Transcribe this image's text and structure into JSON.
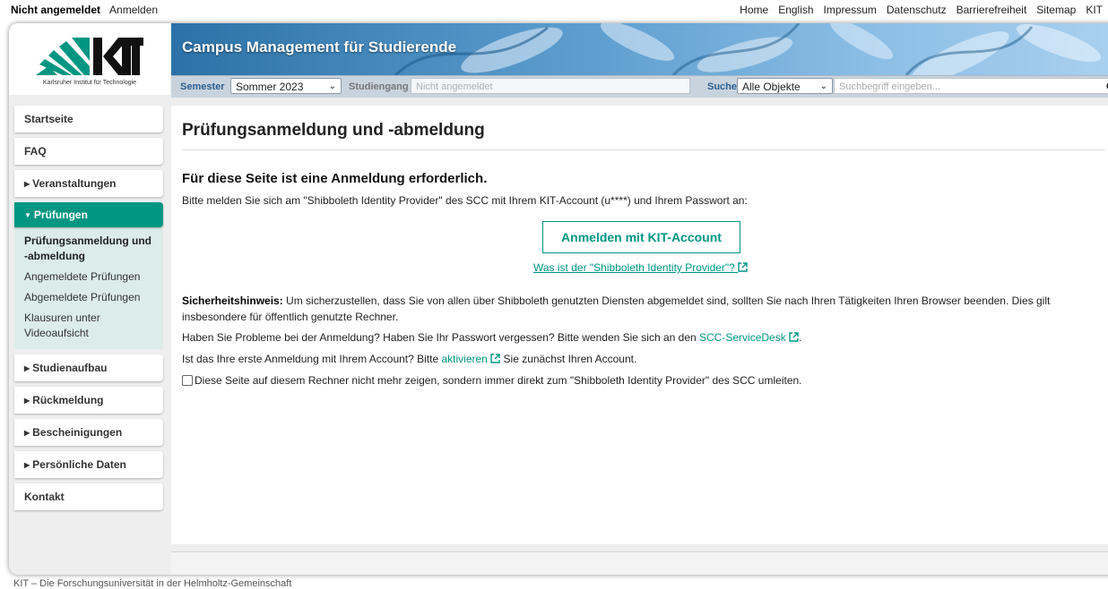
{
  "topbar": {
    "status": "Nicht angemeldet",
    "login_link": "Anmelden",
    "links": [
      "Home",
      "English",
      "Impressum",
      "Datenschutz",
      "Barrierefreiheit",
      "Sitemap",
      "KIT"
    ]
  },
  "header": {
    "logo_subtitle": "Karlsruher Institut für Technologie",
    "banner_title": "Campus Management für Studierende",
    "semester_label": "Semester",
    "semester_value": "Sommer 2023",
    "studiengang_label": "Studiengang",
    "studiengang_placeholder": "Nicht angemeldet",
    "search_label": "Suche",
    "search_scope": "Alle Objekte",
    "search_placeholder": "Suchbegriff eingeben..."
  },
  "sidebar": {
    "items_top": [
      {
        "label": "Startseite",
        "arrow": ""
      },
      {
        "label": "FAQ",
        "arrow": ""
      },
      {
        "label": "Veranstaltungen",
        "arrow": "▶"
      }
    ],
    "active": {
      "label": "Prüfungen",
      "arrow": "▼"
    },
    "sub_items": [
      "Prüfungsanmeldung und -abmeldung",
      "Angemeldete Prüfungen",
      "Abgemeldete Prüfungen",
      "Klausuren unter Videoaufsicht"
    ],
    "items_bottom": [
      {
        "label": "Studienaufbau",
        "arrow": "▶"
      },
      {
        "label": "Rückmeldung",
        "arrow": "▶"
      },
      {
        "label": "Bescheinigungen",
        "arrow": "▶"
      },
      {
        "label": "Persönliche Daten",
        "arrow": "▶"
      },
      {
        "label": "Kontakt",
        "arrow": ""
      }
    ]
  },
  "content": {
    "title": "Prüfungsanmeldung und -abmeldung",
    "login_heading": "Für diese Seite ist eine Anmeldung erforderlich.",
    "login_text": "Bitte melden Sie sich am \"Shibboleth Identity Provider\" des SCC mit Ihrem KIT-Account (u****) und Ihrem Passwort an:",
    "login_button": "Anmelden mit KIT-Account",
    "idp_link": "Was ist der \"Shibboleth Identity Provider\"?",
    "security_label": "Sicherheitshinweis:",
    "security_text": " Um sicherzustellen, dass Sie von allen über Shibboleth genutzten Diensten abgemeldet sind, sollten Sie nach Ihren Tätigkeiten Ihren Browser beenden. Dies gilt insbesondere für öffentlich genutzte Rechner.",
    "problems_text": "Haben Sie Probleme bei der Anmeldung? Haben Sie Ihr Passwort vergessen? Bitte wenden Sie sich an den ",
    "servicedesk_link": "SCC-ServiceDesk",
    "problems_end": ".",
    "first_login_pre": "Ist das Ihre erste Anmeldung mit Ihrem Account? Bitte ",
    "activate_link": "aktivieren",
    "first_login_post": " Sie zunächst Ihren Account.",
    "redirect_text": "Diese Seite auf diesem Rechner nicht mehr zeigen, sondern immer direkt zum \"Shibboleth Identity Provider\" des SCC umleiten."
  },
  "footer": {
    "text": "KIT – Die Forschungsuniversität in der Helmholtz-Gemeinschaft"
  },
  "colors": {
    "accent": "#009682",
    "banner": "#4a8cc4",
    "sidebar_sub_bg": "#dcece9"
  }
}
